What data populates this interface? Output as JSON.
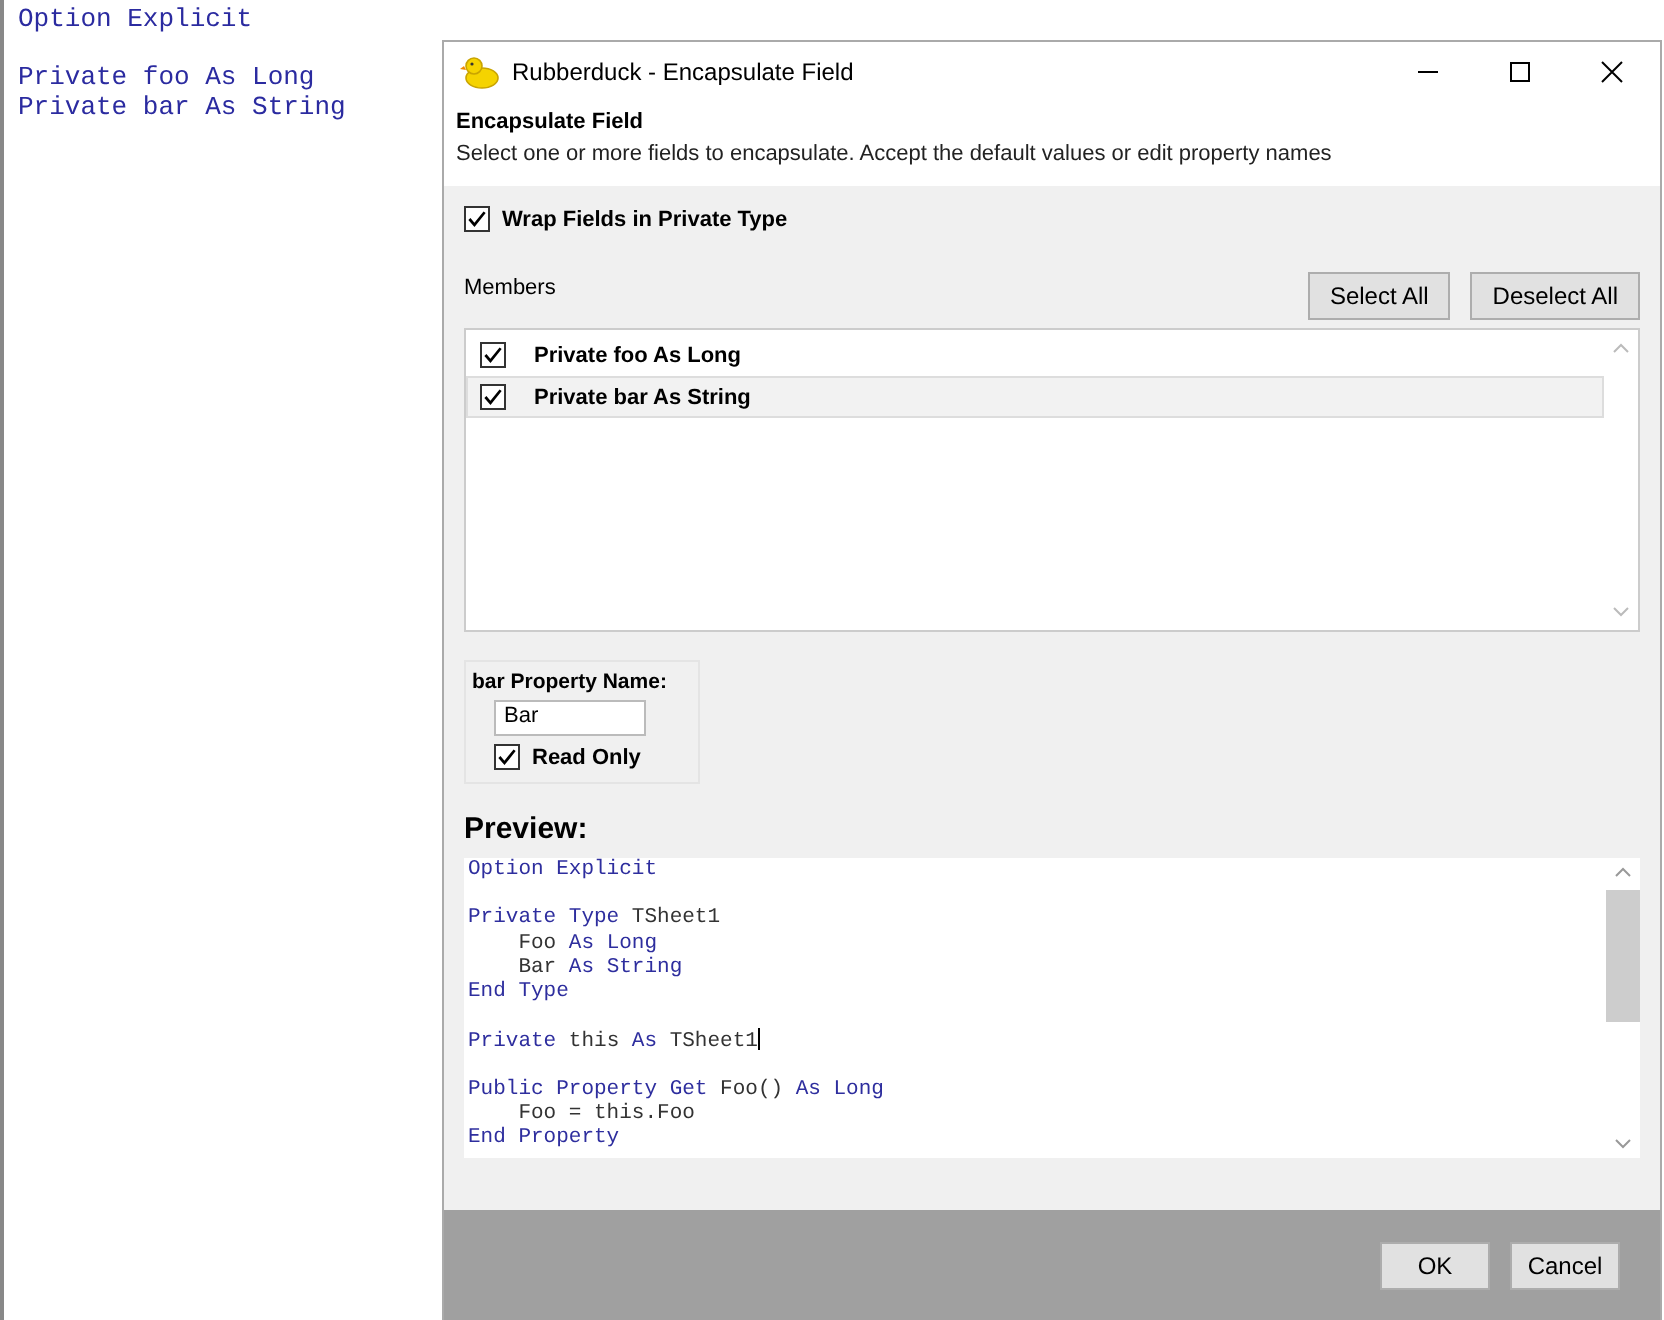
{
  "editor": {
    "lines": [
      {
        "kind": "code",
        "text": "Option Explicit"
      },
      {
        "kind": "blank"
      },
      {
        "kind": "code",
        "text": "Private foo As Long"
      },
      {
        "kind": "code",
        "text": "Private bar As String"
      }
    ]
  },
  "dialog": {
    "title": "Rubberduck - Encapsulate Field",
    "heading": "Encapsulate Field",
    "instructions": "Select one or more fields to encapsulate.  Accept the default values or edit property names",
    "wrap_option": {
      "label": "Wrap Fields in Private Type",
      "checked": true
    },
    "members_label": "Members",
    "member_buttons": [
      "Select All",
      "Deselect All"
    ],
    "members": [
      {
        "label": "Private foo As Long",
        "checked": true,
        "selected": false
      },
      {
        "label": "Private bar As String",
        "checked": true,
        "selected": true
      }
    ],
    "property_group": {
      "label": "bar Property Name:",
      "value": "Bar",
      "read_only": {
        "label": "Read Only",
        "checked": true
      }
    },
    "preview_label": "Preview:",
    "preview": [
      {
        "kind": "code",
        "tokens": [
          {
            "kind": "keyword",
            "text": "Option Explicit"
          }
        ]
      },
      {
        "kind": "blank"
      },
      {
        "kind": "code",
        "tokens": [
          {
            "kind": "keyword",
            "text": "Private Type"
          },
          {
            "kind": "plain",
            "text": " TSheet1"
          }
        ]
      },
      {
        "kind": "code",
        "tokens": [
          {
            "kind": "plain",
            "text": "    Foo "
          },
          {
            "kind": "keyword",
            "text": "As Long"
          }
        ]
      },
      {
        "kind": "code",
        "tokens": [
          {
            "kind": "plain",
            "text": "    Bar "
          },
          {
            "kind": "keyword",
            "text": "As String"
          }
        ]
      },
      {
        "kind": "code",
        "tokens": [
          {
            "kind": "keyword",
            "text": "End Type"
          }
        ]
      },
      {
        "kind": "blank"
      },
      {
        "kind": "code",
        "tokens": [
          {
            "kind": "keyword",
            "text": "Private"
          },
          {
            "kind": "plain",
            "text": " this "
          },
          {
            "kind": "keyword",
            "text": "As"
          },
          {
            "kind": "plain",
            "text": " TSheet1"
          }
        ],
        "caret": true
      },
      {
        "kind": "blank"
      },
      {
        "kind": "code",
        "tokens": [
          {
            "kind": "keyword",
            "text": "Public Property Get"
          },
          {
            "kind": "plain",
            "text": " Foo() "
          },
          {
            "kind": "keyword",
            "text": "As Long"
          }
        ]
      },
      {
        "kind": "code",
        "tokens": [
          {
            "kind": "plain",
            "text": "    Foo = this.Foo"
          }
        ]
      },
      {
        "kind": "code",
        "tokens": [
          {
            "kind": "keyword",
            "text": "End Property"
          }
        ]
      }
    ],
    "footer_buttons": [
      "OK",
      "Cancel"
    ]
  }
}
